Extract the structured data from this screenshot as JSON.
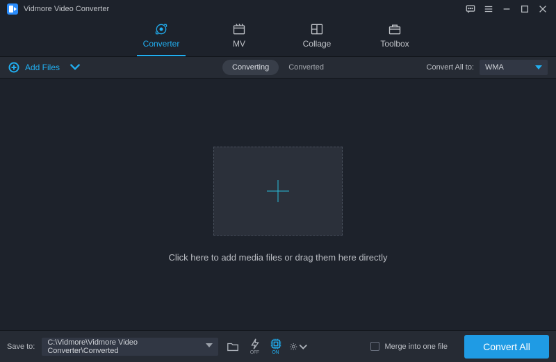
{
  "app": {
    "title": "Vidmore Video Converter"
  },
  "tabs": {
    "converter": "Converter",
    "mv": "MV",
    "collage": "Collage",
    "toolbox": "Toolbox"
  },
  "toolbar": {
    "add_files": "Add Files",
    "seg_converting": "Converting",
    "seg_converted": "Converted",
    "convert_all_to": "Convert All to:",
    "selected_format": "WMA"
  },
  "dropzone": {
    "hint": "Click here to add media files or drag them here directly"
  },
  "bottom": {
    "save_to": "Save to:",
    "path": "C:\\Vidmore\\Vidmore Video Converter\\Converted",
    "flash_sub": "OFF",
    "gpu_sub": "ON",
    "merge": "Merge into one file",
    "convert_all": "Convert All"
  }
}
